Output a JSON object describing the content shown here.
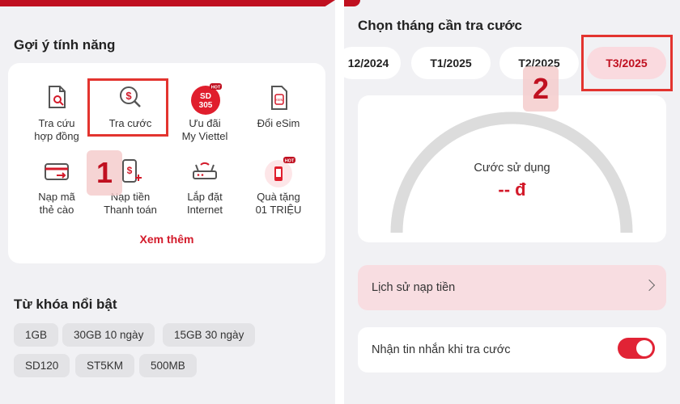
{
  "left": {
    "features_title": "Gợi ý tính năng",
    "features": [
      {
        "label": "Tra cứu\nhợp đồng",
        "icon": "contract-search-icon"
      },
      {
        "label": "Tra cước",
        "icon": "money-search-icon"
      },
      {
        "label": "Ưu đãi\nMy Viettel",
        "icon": "sd305-promo-icon",
        "icon_text": "SD\n305",
        "badge": "HOT"
      },
      {
        "label": "Đổi eSim",
        "icon": "esim-icon",
        "icon_text": "eSIM"
      },
      {
        "label": "Nạp mã\nthẻ cào",
        "icon": "scratch-card-icon"
      },
      {
        "label": "Nạp tiền\nThanh toán",
        "icon": "topup-phone-icon"
      },
      {
        "label": "Lắp đặt\nInternet",
        "icon": "router-icon"
      },
      {
        "label": "Quà tặng\n01 TRIỆU",
        "icon": "gift-phone-icon",
        "badge": "HOT"
      }
    ],
    "see_more": "Xem thêm",
    "keywords_title": "Từ khóa nổi bật",
    "keywords": [
      "1GB",
      "30GB 10 ngày",
      "15GB 30 ngày",
      "SD120",
      "ST5KM",
      "500MB"
    ],
    "step_label": "1"
  },
  "right": {
    "month_title": "Chọn tháng cần tra cước",
    "months": [
      "12/2024",
      "T1/2025",
      "T2/2025",
      "T3/2025"
    ],
    "selected_month": "T3/2025",
    "usage_label": "Cước sử dụng",
    "usage_value": "-- đ",
    "history_label": "Lịch sử nạp tiền",
    "sms_label": "Nhận tin nhắn khi tra cước",
    "sms_enabled": true,
    "step_label": "2"
  },
  "colors": {
    "brand_red": "#c01020",
    "accent_red": "#e12335",
    "highlight_box": "#e3342f"
  }
}
